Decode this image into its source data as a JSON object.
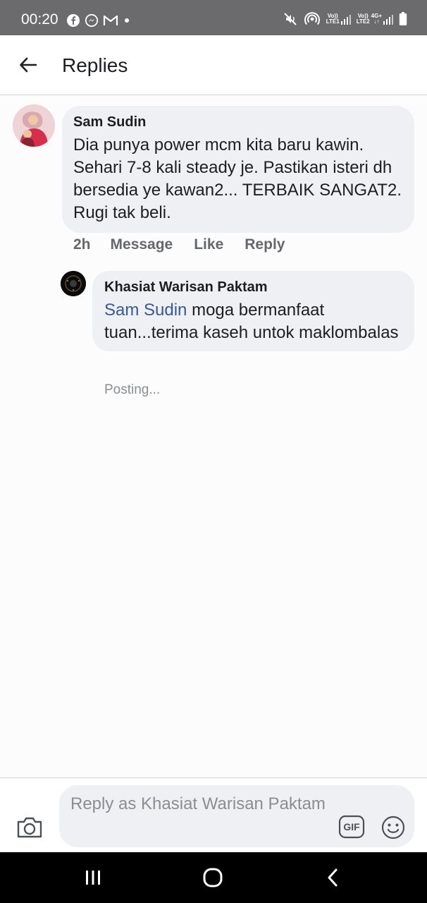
{
  "status_bar": {
    "time": "00:20",
    "sim1_top": "Vo))",
    "sim1_bottom": "LTE1",
    "sim2_top": "Vo))",
    "sim2_bottom": "LTE2",
    "network": "4G+",
    "icons": [
      "facebook-icon",
      "messenger-icon",
      "gmail-icon",
      "dot-icon",
      "mute-icon",
      "hotspot-icon",
      "signal-icon",
      "battery-icon"
    ]
  },
  "app_bar": {
    "title": "Replies"
  },
  "comment": {
    "author": "Sam Sudin",
    "text": "Dia punya power mcm kita baru kawin. Sehari 7-8 kali steady je. Pastikan isteri dh bersedia ye kawan2... TERBAIK SANGAT2. Rugi tak beli.",
    "time": "2h",
    "actions": {
      "message": "Message",
      "like": "Like",
      "reply": "Reply"
    }
  },
  "reply": {
    "author": "Khasiat Warisan Paktam",
    "mention": "Sam Sudin",
    "text": "moga bermanfaat tuan...terima kaseh untok maklombalas",
    "status": "Posting..."
  },
  "composer": {
    "placeholder": "Reply as Khasiat Warisan Paktam",
    "value": "",
    "gif_label": "GIF"
  },
  "colors": {
    "status_bar": "#6b6b6d",
    "bubble": "#eff0f4",
    "mention": "#385898",
    "meta": "#65676b",
    "nav_bar": "#000000"
  }
}
